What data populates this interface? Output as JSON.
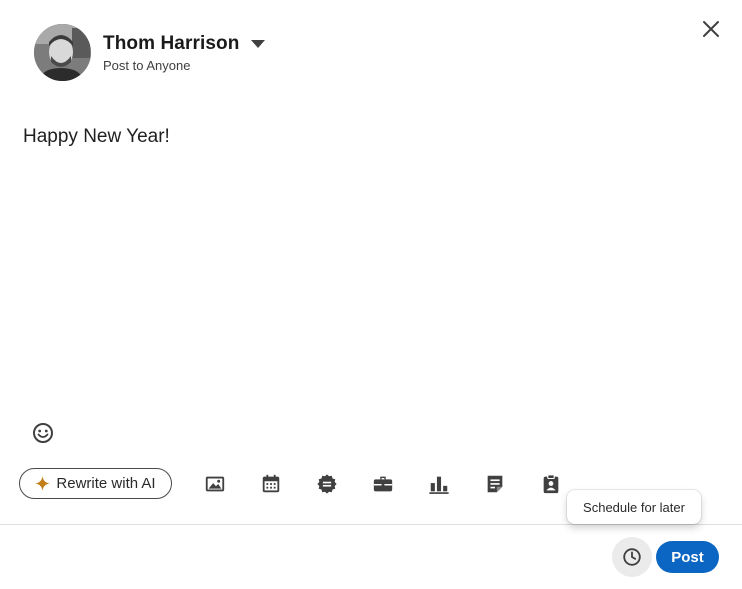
{
  "author": {
    "name": "Thom Harrison",
    "visibility": "Post to Anyone"
  },
  "editor": {
    "text": "Happy New Year!"
  },
  "toolbar": {
    "rewrite_label": "Rewrite with AI",
    "tools": [
      "image-icon",
      "calendar-event-icon",
      "celebrate-badge-icon",
      "briefcase-icon",
      "poll-chart-icon",
      "document-icon",
      "clipboard-icon"
    ]
  },
  "footer": {
    "tooltip": "Schedule for later",
    "post_label": "Post"
  },
  "colors": {
    "primary": "#0a66c2",
    "ai_spark": "#c37d16",
    "icon": "#404040"
  }
}
